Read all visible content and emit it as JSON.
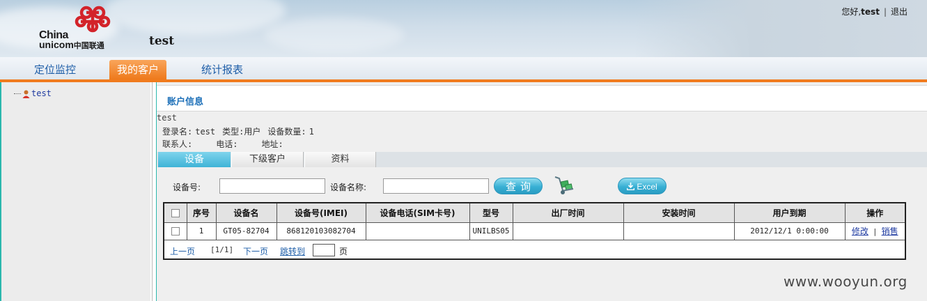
{
  "header": {
    "logo": {
      "brand_en_line1": "China",
      "brand_en_line2": "unicom",
      "brand_cn": "中国联通"
    },
    "site_title": "test",
    "greeting": "您好,",
    "username": "test",
    "logout_label": "退出"
  },
  "nav": {
    "items": [
      {
        "label": "定位监控",
        "active": false
      },
      {
        "label": "我的客户",
        "active": true
      },
      {
        "label": "统计报表",
        "active": false
      }
    ],
    "accent_color": "#f07b1e"
  },
  "tree": {
    "root_label": "test"
  },
  "panel": {
    "title": "账户信息",
    "account_name": "test",
    "login_label": "登录名:",
    "login_value": "test",
    "type_label": "类型:",
    "type_value": "用户",
    "device_count_label": "设备数量:",
    "device_count_value": "1",
    "contact_label": "联系人:",
    "contact_value": "",
    "phone_label": "电话:",
    "phone_value": "",
    "address_label": "地址:",
    "address_value": ""
  },
  "subtabs": [
    {
      "label": "设备",
      "active": true
    },
    {
      "label": "下级客户",
      "active": false
    },
    {
      "label": "资料",
      "active": false
    }
  ],
  "search": {
    "device_no_label": "设备号:",
    "device_no_value": "",
    "device_name_label": "设备名称:",
    "device_name_value": "",
    "query_label": "查询",
    "excel_label": "Excel"
  },
  "table": {
    "columns": [
      "",
      "序号",
      "设备名",
      "设备号(IMEI)",
      "设备电话(SIM卡号)",
      "型号",
      "出厂时间",
      "安装时间",
      "用户到期",
      "操作"
    ],
    "rows": [
      {
        "index": "1",
        "device_name": "GT05-82704",
        "imei": "868120103082704",
        "sim": "",
        "model": "UNILBS05",
        "factory_time": "",
        "install_time": "",
        "expire": "2012/12/1 0:00:00",
        "edit_label": "修改",
        "cancel_label": "销售"
      }
    ]
  },
  "pager": {
    "prev_label": "上一页",
    "page_info": "[1/1]",
    "next_label": "下一页",
    "jump_label": "跳转到",
    "page_unit": "页"
  },
  "watermark": "www.wooyun.org"
}
